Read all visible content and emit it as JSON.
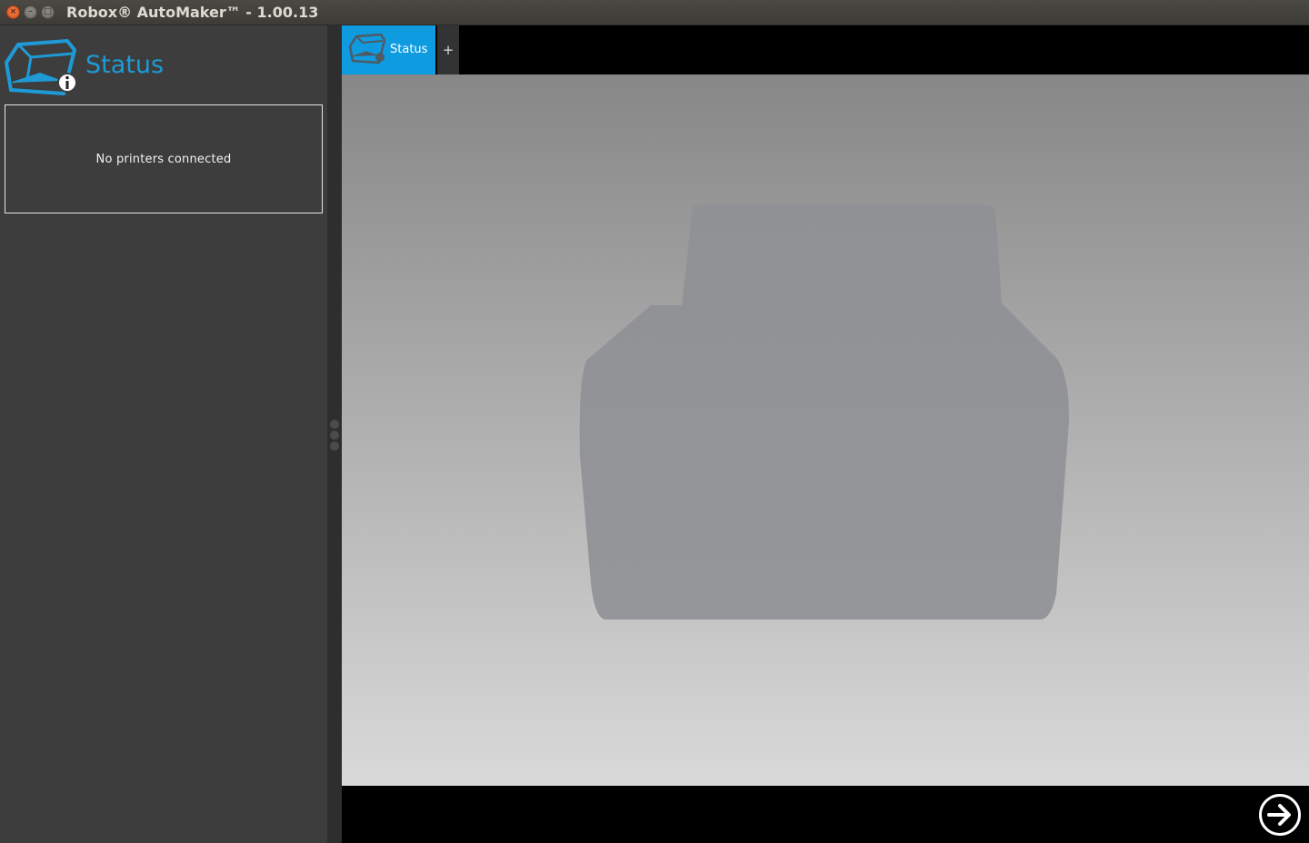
{
  "window": {
    "title": "Robox® AutoMaker™ - 1.00.13",
    "controls": [
      "close-icon",
      "minimize-icon",
      "maximize-icon"
    ]
  },
  "sidebar": {
    "heading": "Status",
    "printers_message": "No printers connected"
  },
  "tabs": [
    {
      "label": "Status",
      "selected": true
    },
    {
      "label": "+",
      "selected": false
    }
  ],
  "colors": {
    "accent": "#0f9be0",
    "heading": "#1e9bd7",
    "sidebar_bg": "#3d3d3d"
  },
  "icons": {
    "status_logo": "printer-info-icon",
    "tab_icon": "printer-status-icon",
    "next": "arrow-right-circle-icon"
  }
}
